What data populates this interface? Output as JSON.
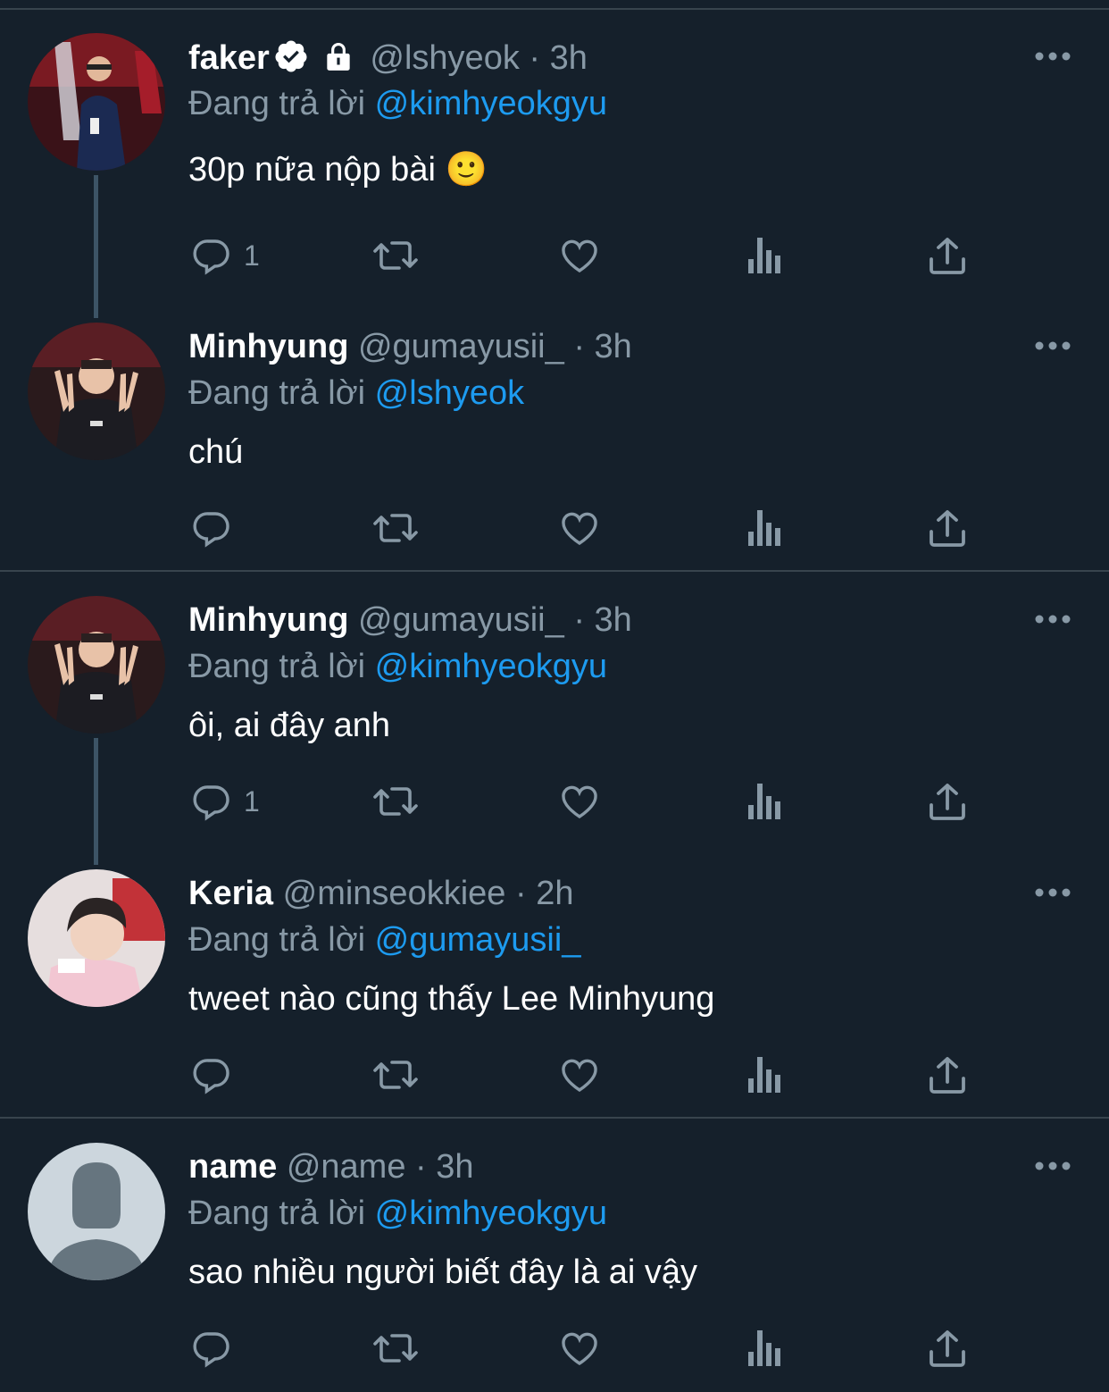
{
  "app": {
    "accent_color": "#1d9bf0",
    "background": "#15202b",
    "muted_color": "#8899a6"
  },
  "tweets": [
    {
      "name": "faker",
      "verified": true,
      "protected": true,
      "handle": "@lshyeok",
      "separator": "·",
      "time": "3h",
      "reply_prefix": "Đang trả lời",
      "reply_to": "@kimhyeokgyu",
      "text": "30p nữa nộp bài 🙂",
      "reply_count": "1",
      "avatar_icon": "player-photo-avatar"
    },
    {
      "name": "Minhyung",
      "handle": "@gumayusii_",
      "separator": "·",
      "time": "3h",
      "reply_prefix": "Đang trả lời",
      "reply_to": "@lshyeok",
      "text": "chú",
      "reply_count": "",
      "avatar_icon": "peace-sign-photo-avatar"
    },
    {
      "name": "Minhyung",
      "handle": "@gumayusii_",
      "separator": "·",
      "time": "3h",
      "reply_prefix": "Đang trả lời",
      "reply_to": "@kimhyeokgyu",
      "text": "ôi, ai đây anh",
      "reply_count": "1",
      "avatar_icon": "peace-sign-photo-avatar"
    },
    {
      "name": "Keria",
      "handle": "@minseokkiee",
      "separator": "·",
      "time": "2h",
      "reply_prefix": "Đang trả lời",
      "reply_to": "@gumayusii_",
      "text": "tweet nào cũng thấy Lee Minhyung",
      "reply_count": "",
      "avatar_icon": "selfie-photo-avatar"
    },
    {
      "name": "name",
      "handle": "@name",
      "separator": "·",
      "time": "3h",
      "reply_prefix": "Đang trả lời",
      "reply_to": "@kimhyeokgyu",
      "text": "sao nhiều người biết đây là ai vậy",
      "reply_count": "",
      "avatar_icon": "default-person-avatar"
    }
  ],
  "action_icons": [
    "reply-icon",
    "retweet-icon",
    "like-icon",
    "views-icon",
    "share-icon"
  ]
}
